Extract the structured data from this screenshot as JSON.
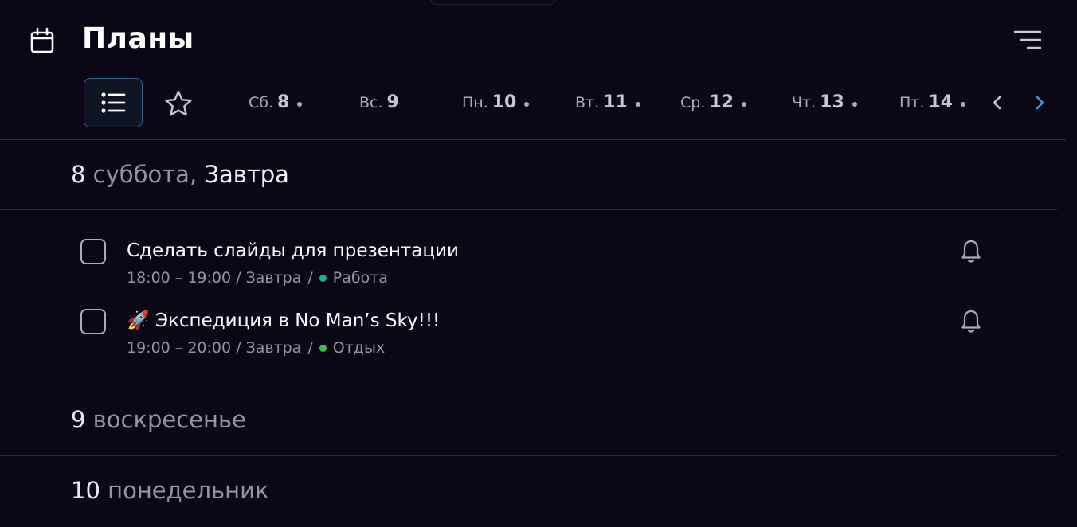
{
  "app": {
    "title": "Планы"
  },
  "tabs": {
    "days": [
      {
        "name": "Сб.",
        "num": "8",
        "has_dot": true
      },
      {
        "name": "Вс.",
        "num": "9",
        "has_dot": false
      },
      {
        "name": "Пн.",
        "num": "10",
        "has_dot": true
      },
      {
        "name": "Вт.",
        "num": "11",
        "has_dot": true
      },
      {
        "name": "Ср.",
        "num": "12",
        "has_dot": true
      },
      {
        "name": "Чт.",
        "num": "13",
        "has_dot": true
      },
      {
        "name": "Пт.",
        "num": "14",
        "has_dot": true
      }
    ]
  },
  "days": [
    {
      "num": "8",
      "weekday": "суббота,",
      "relative": "Завтра",
      "tasks": [
        {
          "title": "Сделать слайды для презентации",
          "time": "18:00 – 19:00 / Завтра",
          "separator": "/",
          "category": "Работа",
          "category_color": "#1fae8c"
        },
        {
          "title": "🚀 Экспедиция в No Man’s Sky!!!",
          "time": "19:00 – 20:00 / Завтра",
          "separator": "/",
          "category": "Отдых",
          "category_color": "#3fb950"
        }
      ]
    },
    {
      "num": "9",
      "weekday": "воскресенье"
    },
    {
      "num": "10",
      "weekday": "понедельник"
    }
  ],
  "colors": {
    "background": "#0c0716",
    "accent": "#3b8fd6",
    "divider": "#2a2c38"
  }
}
